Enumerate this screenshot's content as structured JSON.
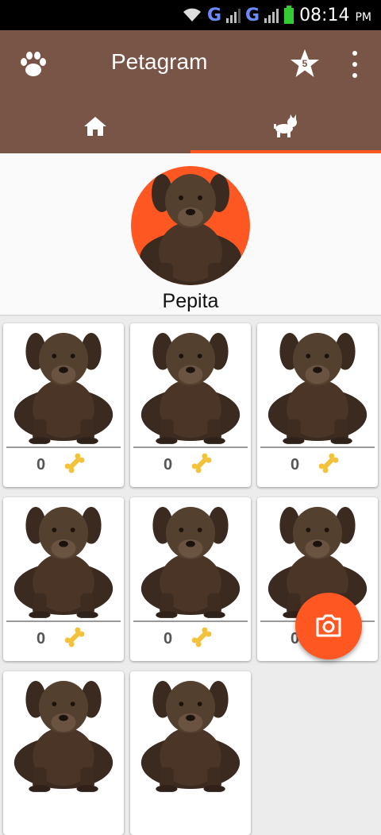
{
  "status_bar": {
    "network_1": "G",
    "network_2": "G",
    "time": "08:14",
    "ampm": "PM"
  },
  "toolbar": {
    "title": "Petagram",
    "favorites_count": "5"
  },
  "tabs": [
    {
      "icon": "home-icon",
      "active": false
    },
    {
      "icon": "dog-icon",
      "active": true
    }
  ],
  "profile": {
    "name": "Pepita"
  },
  "grid": {
    "cards": [
      {
        "likes": "0"
      },
      {
        "likes": "0"
      },
      {
        "likes": "0"
      },
      {
        "likes": "0"
      },
      {
        "likes": "0"
      },
      {
        "likes": "0"
      },
      {
        "likes": ""
      },
      {
        "likes": ""
      }
    ]
  },
  "colors": {
    "primary": "#795548",
    "accent": "#ff5722"
  }
}
